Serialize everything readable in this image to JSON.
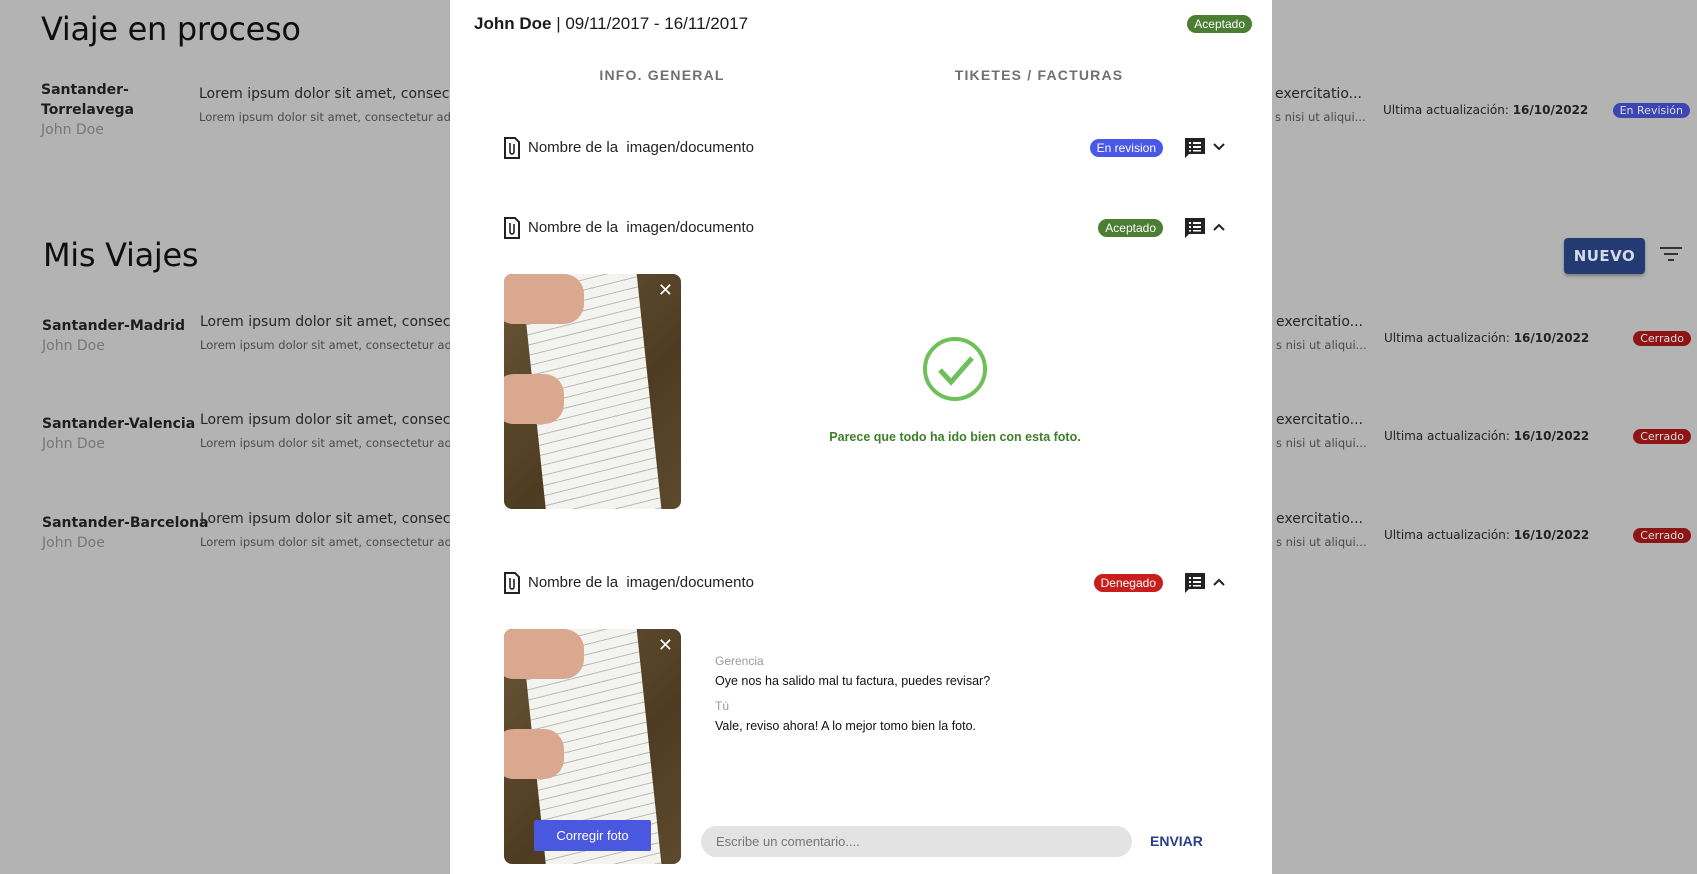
{
  "background": {
    "in_progress": {
      "title": "Viaje en proceso",
      "trip": {
        "route": "Santander-Torrelavega",
        "user": "John Doe",
        "desc1": "Lorem ipsum dolor sit amet, consectet",
        "desc1_tail": "exercitatio...",
        "desc2": "Lorem ipsum dolor sit amet, consectetur adip",
        "desc2_tail": "s nisi ut aliqui...",
        "updated_label": "Ultima actualización:",
        "updated_date": "16/10/2022",
        "status": "En Revisión"
      }
    },
    "my_trips": {
      "title": "Mis Viajes",
      "new_label": "NUEVO",
      "trips": [
        {
          "route": "Santander-Madrid",
          "user": "John Doe",
          "desc1": "Lorem ipsum dolor sit amet, consectet",
          "desc1_tail": "exercitatio...",
          "desc2": "Lorem ipsum dolor sit amet, consectetur adip",
          "desc2_tail": "s nisi ut aliqui...",
          "updated_label": "Ultima actualización:",
          "updated_date": "16/10/2022",
          "status": "Cerrado"
        },
        {
          "route": "Santander-Valencia",
          "user": "John Doe",
          "desc1": "Lorem ipsum dolor sit amet, consectet",
          "desc1_tail": "exercitatio...",
          "desc2": "Lorem ipsum dolor sit amet, consectetur adip",
          "desc2_tail": "s nisi ut aliqui...",
          "updated_label": "Ultima actualización:",
          "updated_date": "16/10/2022",
          "status": "Cerrado"
        },
        {
          "route": "Santander-Barcelona",
          "user": "John Doe",
          "desc1": "Lorem ipsum dolor sit amet, consectet",
          "desc1_tail": "exercitatio...",
          "desc2": "Lorem ipsum dolor sit amet, consectetur adip",
          "desc2_tail": "s nisi ut aliqui...",
          "updated_label": "Ultima actualización:",
          "updated_date": "16/10/2022",
          "status": "Cerrado"
        }
      ]
    }
  },
  "modal": {
    "user": "John Doe",
    "separator": "|",
    "dates": "09/11/2017 - 16/11/2017",
    "status": "Aceptado",
    "tabs": [
      "INFO. GENERAL",
      "TIKETES / FACTURAS"
    ],
    "items": [
      {
        "name": "Nombre de la  imagen/documento",
        "status": "En revision"
      },
      {
        "name": "Nombre de la  imagen/documento",
        "status": "Aceptado",
        "success_message": "Parece que todo ha ido bien con esta foto."
      },
      {
        "name": "Nombre de la  imagen/documento",
        "status": "Denegado",
        "fix_label": "Corregir foto",
        "comments": [
          {
            "author": "Gerencia",
            "text": "Oye nos ha salido mal tu factura, puedes revisar?"
          },
          {
            "author": "Tú",
            "text": "Vale, reviso ahora! A lo mejor tomo bien la foto."
          }
        ],
        "comment_placeholder": "Escribe un comentario....",
        "send_label": "ENVIAR"
      }
    ]
  },
  "colors": {
    "accepted": "#4b7d33",
    "review": "#4a58e8",
    "denied": "#c81e1e",
    "primary": "#243a72"
  }
}
